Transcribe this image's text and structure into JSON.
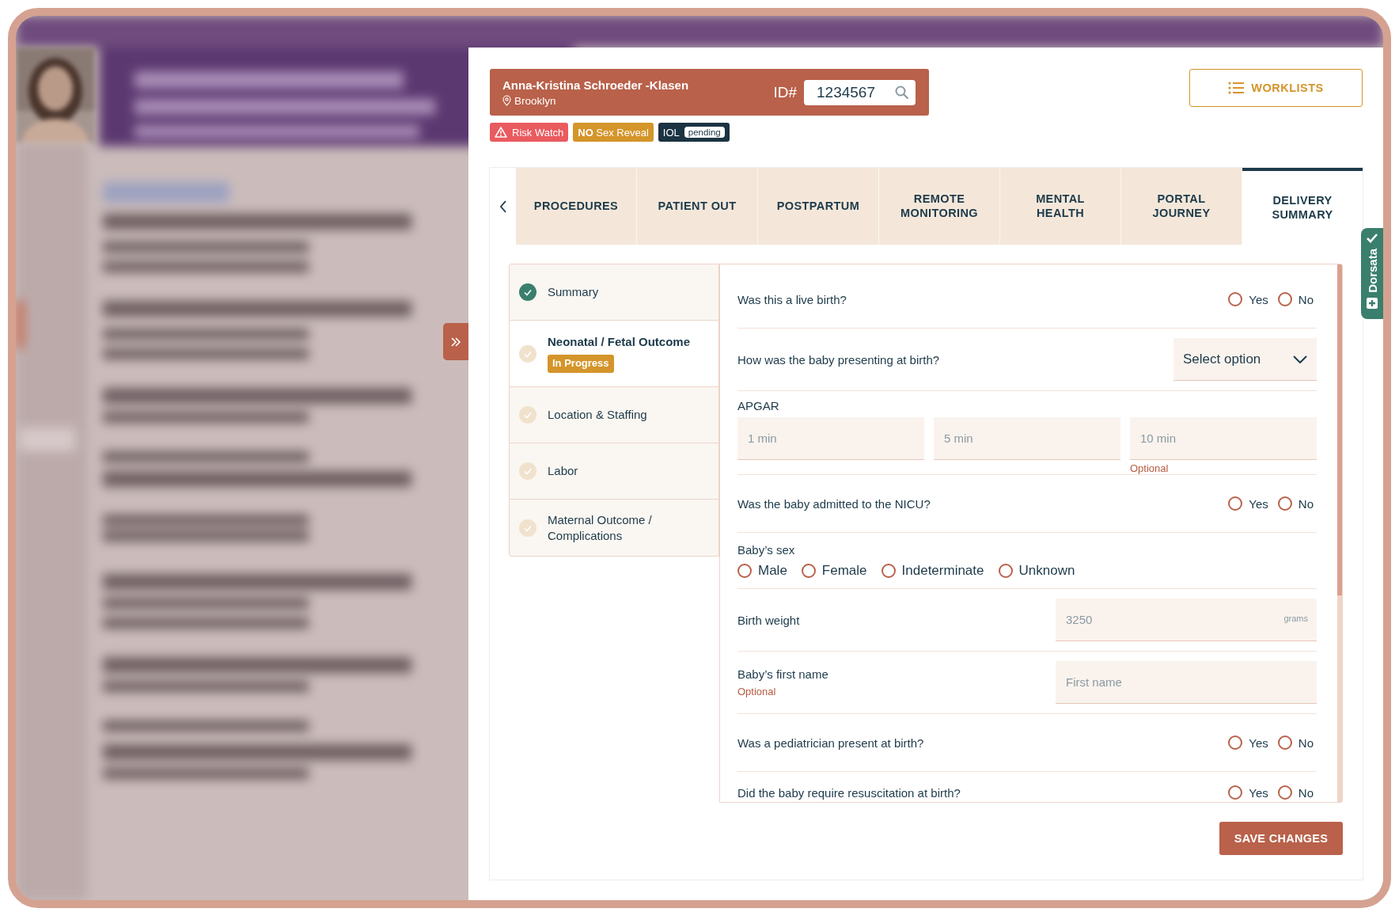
{
  "patient": {
    "name": "Anna-Kristina Schroeder -Klasen",
    "location": "Brooklyn",
    "id_label": "ID#",
    "id_value": "1234567"
  },
  "badges": [
    {
      "kind": "risk",
      "label": "Risk Watch"
    },
    {
      "kind": "reveal",
      "label": "**NO** Sex Reveal"
    },
    {
      "kind": "iol",
      "label": "IOL",
      "status": "pending"
    }
  ],
  "worklists_button": "WORKLISTS",
  "tabs": [
    {
      "label": "PROCEDURES",
      "selected": false
    },
    {
      "label": "PATIENT OUT",
      "selected": false
    },
    {
      "label": "POSTPARTUM",
      "selected": false
    },
    {
      "label": "REMOTE MONITORING",
      "selected": false
    },
    {
      "label": "MENTAL HEALTH",
      "selected": false
    },
    {
      "label": "PORTAL JOURNEY",
      "selected": false
    },
    {
      "label": "DELIVERY SUMMARY",
      "selected": true
    }
  ],
  "steps": [
    {
      "label": "Summary",
      "complete": true,
      "selected": false
    },
    {
      "label": "Neonatal / Fetal Outcome",
      "complete": false,
      "selected": true,
      "badge": "In Progress"
    },
    {
      "label": "Location & Staffing",
      "complete": false,
      "selected": false
    },
    {
      "label": "Labor",
      "complete": false,
      "selected": false
    },
    {
      "label": "Maternal Outcome / Complications",
      "complete": false,
      "selected": false
    }
  ],
  "form": [
    {
      "kind": "radio",
      "label": "Was this a live birth?",
      "options": [
        {
          "label": "Yes",
          "selected": false
        },
        {
          "label": "No",
          "selected": false
        }
      ]
    },
    {
      "kind": "select",
      "label": "How was the baby presenting at birth?",
      "placeholder": "Select option"
    },
    {
      "kind": "apgar",
      "label": "APGAR",
      "fields": [
        {
          "placeholder": "1 min"
        },
        {
          "placeholder": "5 min"
        },
        {
          "placeholder": "10 min",
          "helper": "Optional"
        }
      ]
    },
    {
      "kind": "radio",
      "label": "Was the baby admitted to the NICU?",
      "options": [
        {
          "label": "Yes",
          "selected": false
        },
        {
          "label": "No",
          "selected": false
        }
      ]
    },
    {
      "kind": "inline_radio",
      "label": "Baby’s sex",
      "options": [
        {
          "label": "Male",
          "selected": false
        },
        {
          "label": "Female",
          "selected": false
        },
        {
          "label": "Indeterminate",
          "selected": false
        },
        {
          "label": "Unknown",
          "selected": false
        }
      ]
    },
    {
      "kind": "input",
      "label": "Birth weight",
      "placeholder": "3250",
      "unit": "grams"
    },
    {
      "kind": "input",
      "label": "Baby’s first name",
      "helper": "Optional",
      "placeholder": "First name"
    },
    {
      "kind": "radio",
      "label": "Was a pediatrician present at birth?",
      "options": [
        {
          "label": "Yes",
          "selected": false
        },
        {
          "label": "No",
          "selected": false
        }
      ]
    },
    {
      "kind": "radio",
      "label": "Did the baby require resuscitation at birth?",
      "options": [
        {
          "label": "Yes",
          "selected": false
        },
        {
          "label": "No",
          "selected": false
        }
      ]
    }
  ],
  "save_button": "SAVE CHANGES",
  "side_tab": "Dorsata"
}
